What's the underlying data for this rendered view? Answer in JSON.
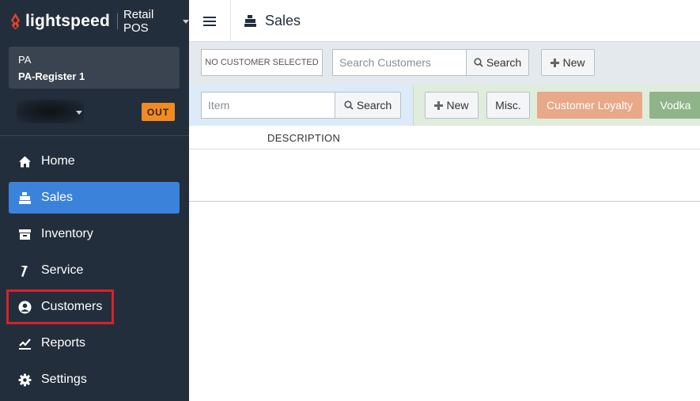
{
  "brand": {
    "name": "lightspeed",
    "product": "Retail POS",
    "accent": "#e8412c"
  },
  "register": {
    "short": "PA",
    "name": "PA-Register 1"
  },
  "user": {
    "status_badge": "OUT"
  },
  "sidebar": {
    "items": [
      {
        "label": "Home",
        "icon": "home-icon"
      },
      {
        "label": "Sales",
        "icon": "register-icon",
        "active": true
      },
      {
        "label": "Inventory",
        "icon": "inventory-icon"
      },
      {
        "label": "Service",
        "icon": "hammer-icon"
      },
      {
        "label": "Customers",
        "icon": "user-circle-icon",
        "highlighted": true
      },
      {
        "label": "Reports",
        "icon": "chart-line-icon"
      },
      {
        "label": "Settings",
        "icon": "gear-icon"
      }
    ],
    "active_color": "#3b82db",
    "highlight_color": "#d8222a"
  },
  "header": {
    "title": "Sales"
  },
  "customer": {
    "selected_text": "NO CUSTOMER SELECTED",
    "search_placeholder": "Search Customers",
    "search_button": "Search",
    "new_button": "New"
  },
  "items": {
    "search_placeholder": "Item",
    "search_button": "Search",
    "new_button": "New",
    "misc_button": "Misc.",
    "quick_buttons": [
      {
        "label": "Customer Loyalty",
        "color": "#e9a888"
      },
      {
        "label": "Vodka",
        "color": "#8fb48a"
      }
    ]
  },
  "table": {
    "columns": [
      "DESCRIPTION"
    ]
  }
}
